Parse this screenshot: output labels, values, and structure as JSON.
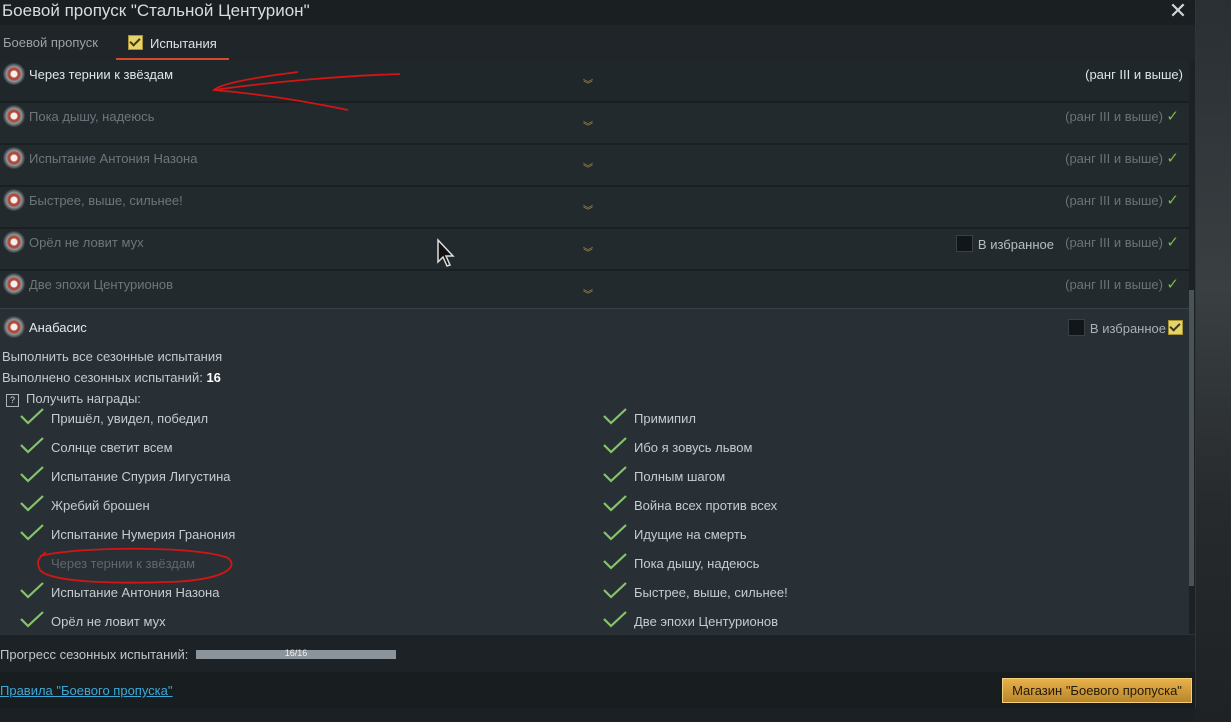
{
  "window": {
    "title": "Боевой пропуск \"Стальной Центурион\""
  },
  "tabs": [
    {
      "label": "Боевой пропуск"
    },
    {
      "label": "Испытания"
    }
  ],
  "challenges": [
    {
      "name": "Через тернии к звёздам",
      "rank": "(ранг III и выше)",
      "done": false
    },
    {
      "name": "Пока дышу, надеюсь",
      "rank": "(ранг III и выше)",
      "done": true
    },
    {
      "name": "Испытание Антония Назона",
      "rank": "(ранг III и выше)",
      "done": true
    },
    {
      "name": "Быстрее, выше, сильнее!",
      "rank": "(ранг III и выше)",
      "done": true
    },
    {
      "name": "Орёл не ловит мух",
      "rank": "(ранг III и выше)",
      "done": true,
      "favorite_label": "В избранное"
    },
    {
      "name": "Две эпохи Центурионов",
      "rank": "(ранг III и выше)",
      "done": true
    }
  ],
  "expanded": {
    "title": "Анабасис",
    "favorite_label": "В избранное",
    "description": "Выполнить все сезонные испытания",
    "completed_label": "Выполнено сезонных испытаний:",
    "completed_count": "16",
    "rewards_label": "Получить награды:",
    "left_column": [
      {
        "label": "Пришёл, увидел, победил",
        "done": true
      },
      {
        "label": "Солнце светит всем",
        "done": true
      },
      {
        "label": "Испытание Спурия Лигустина",
        "done": true
      },
      {
        "label": "Жребий брошен",
        "done": true
      },
      {
        "label": "Испытание Нумерия Гранония",
        "done": true
      },
      {
        "label": "Через тернии к звёздам",
        "done": false
      },
      {
        "label": "Испытание Антония Назона",
        "done": true
      },
      {
        "label": "Орёл не ловит мух",
        "done": true
      }
    ],
    "right_column": [
      {
        "label": "Примипил",
        "done": true
      },
      {
        "label": "Ибо я зовусь львом",
        "done": true
      },
      {
        "label": "Полным шагом",
        "done": true
      },
      {
        "label": "Война всех против всех",
        "done": true
      },
      {
        "label": "Идущие на смерть",
        "done": true
      },
      {
        "label": "Пока дышу, надеюсь",
        "done": true
      },
      {
        "label": "Быстрее, выше, сильнее!",
        "done": true
      },
      {
        "label": "Две эпохи Центурионов",
        "done": true
      }
    ]
  },
  "progress": {
    "label": "Прогресс сезонных испытаний:",
    "text": "16/16",
    "fraction": 1.0
  },
  "footer": {
    "rules_link": "Правила \"Боевого пропуска\"",
    "shop_button": "Магазин \"Боевого пропуска\""
  },
  "colors": {
    "accent": "#d24a2b",
    "check": "#7fba3f",
    "link": "#3ea8d8",
    "annotation": "#e01616"
  }
}
